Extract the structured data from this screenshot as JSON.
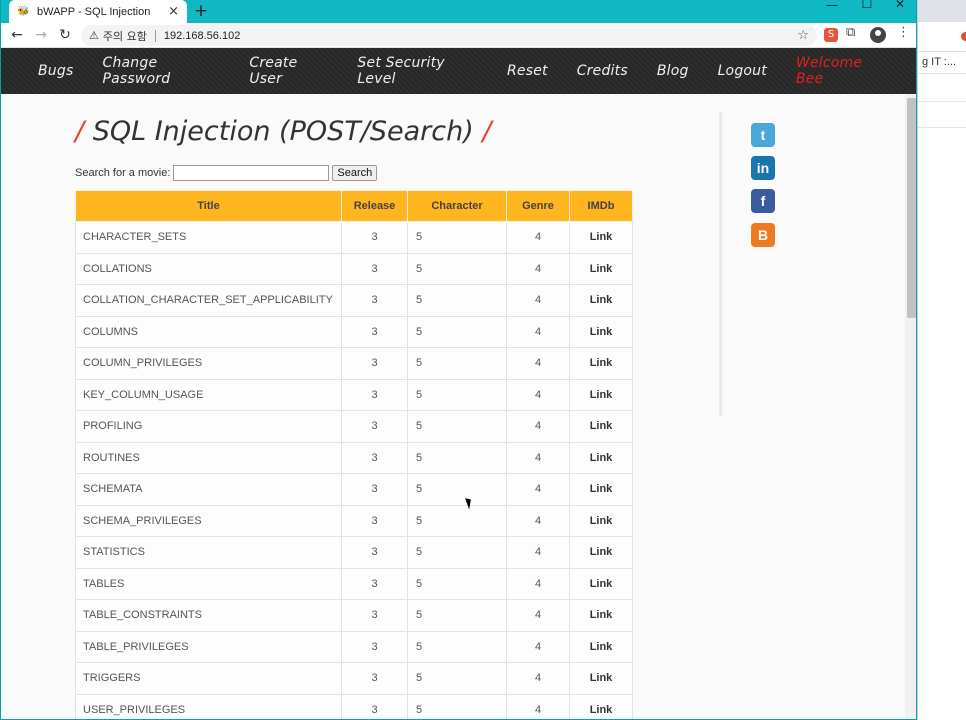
{
  "window": {
    "tab_title": "bWAPP - SQL Injection",
    "tab_close": "×",
    "new_tab": "+",
    "minimize": "—",
    "maximize": "☐",
    "close": "✕"
  },
  "toolbar": {
    "back": "←",
    "forward": "→",
    "reload": "↻",
    "security_icon": "⚠",
    "security_label": "주의 요함",
    "url": "192.168.56.102",
    "bookmark": "☆",
    "ext_icon": "S",
    "puzzle": "⧉",
    "menu": "⋮"
  },
  "background_window": {
    "bookmark_text": "g IT :..."
  },
  "nav": {
    "items": [
      {
        "label": "Bugs"
      },
      {
        "label": "Change Password"
      },
      {
        "label": "Create User"
      },
      {
        "label": "Set Security Level"
      },
      {
        "label": "Reset"
      },
      {
        "label": "Credits"
      },
      {
        "label": "Blog"
      },
      {
        "label": "Logout"
      }
    ],
    "welcome": "Welcome Bee"
  },
  "page": {
    "slash": "/",
    "title": "SQL Injection (POST/Search)",
    "search_label": "Search for a movie:",
    "search_value": "",
    "search_button": "Search"
  },
  "table": {
    "headers": [
      "Title",
      "Release",
      "Character",
      "Genre",
      "IMDb"
    ],
    "rows": [
      {
        "title": "CHARACTER_SETS",
        "release": "3",
        "character": "5",
        "genre": "4",
        "imdb": "Link"
      },
      {
        "title": "COLLATIONS",
        "release": "3",
        "character": "5",
        "genre": "4",
        "imdb": "Link"
      },
      {
        "title": "COLLATION_CHARACTER_SET_APPLICABILITY",
        "release": "3",
        "character": "5",
        "genre": "4",
        "imdb": "Link"
      },
      {
        "title": "COLUMNS",
        "release": "3",
        "character": "5",
        "genre": "4",
        "imdb": "Link"
      },
      {
        "title": "COLUMN_PRIVILEGES",
        "release": "3",
        "character": "5",
        "genre": "4",
        "imdb": "Link"
      },
      {
        "title": "KEY_COLUMN_USAGE",
        "release": "3",
        "character": "5",
        "genre": "4",
        "imdb": "Link"
      },
      {
        "title": "PROFILING",
        "release": "3",
        "character": "5",
        "genre": "4",
        "imdb": "Link"
      },
      {
        "title": "ROUTINES",
        "release": "3",
        "character": "5",
        "genre": "4",
        "imdb": "Link"
      },
      {
        "title": "SCHEMATA",
        "release": "3",
        "character": "5",
        "genre": "4",
        "imdb": "Link"
      },
      {
        "title": "SCHEMA_PRIVILEGES",
        "release": "3",
        "character": "5",
        "genre": "4",
        "imdb": "Link"
      },
      {
        "title": "STATISTICS",
        "release": "3",
        "character": "5",
        "genre": "4",
        "imdb": "Link"
      },
      {
        "title": "TABLES",
        "release": "3",
        "character": "5",
        "genre": "4",
        "imdb": "Link"
      },
      {
        "title": "TABLE_CONSTRAINTS",
        "release": "3",
        "character": "5",
        "genre": "4",
        "imdb": "Link"
      },
      {
        "title": "TABLE_PRIVILEGES",
        "release": "3",
        "character": "5",
        "genre": "4",
        "imdb": "Link"
      },
      {
        "title": "TRIGGERS",
        "release": "3",
        "character": "5",
        "genre": "4",
        "imdb": "Link"
      },
      {
        "title": "USER_PRIVILEGES",
        "release": "3",
        "character": "5",
        "genre": "4",
        "imdb": "Link"
      }
    ]
  },
  "social": [
    {
      "name": "twitter-icon",
      "glyph": "t",
      "color": "#4aa8d8"
    },
    {
      "name": "linkedin-icon",
      "glyph": "in",
      "color": "#1b75ad"
    },
    {
      "name": "facebook-icon",
      "glyph": "f",
      "color": "#3b5ba0"
    },
    {
      "name": "blogger-icon",
      "glyph": "B",
      "color": "#f07a1f"
    }
  ],
  "colors": {
    "accent": "#ffb51e",
    "titlebar": "#0fb8c2",
    "nav_bg": "#2b2b2b",
    "welcome": "#e02020",
    "heading_slash": "#e5462b"
  }
}
